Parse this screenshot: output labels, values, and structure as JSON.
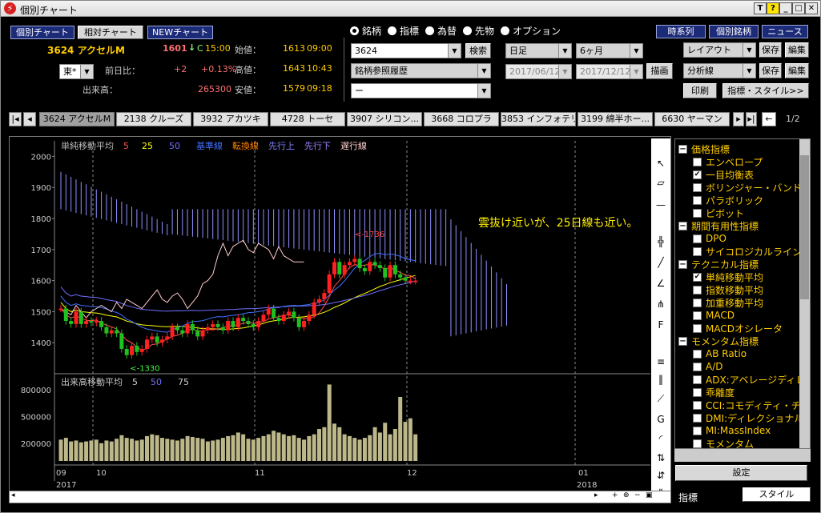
{
  "window": {
    "title": "個別チャート",
    "app_icon": "⚡",
    "buttons": [
      "T",
      "?",
      "_",
      "□",
      "✕"
    ]
  },
  "top_buttons": {
    "kobetsu": "個別チャート",
    "soutai": "相対チャート",
    "new_chart": "NEWチャート",
    "jikeiretsu": "時系列",
    "kobetsu_meigara": "個別銘柄",
    "news": "ニュース"
  },
  "stock": {
    "code_name": "3624 アクセルM",
    "price": "1601",
    "arrow": "↓",
    "flag": "C",
    "time": "15:00",
    "market": "東*",
    "prev_label": "前日比：",
    "change": "+2",
    "change_pct": "+0.13%",
    "volume_label": "出来高：",
    "volume": "265300",
    "open_label": "始値：",
    "open": "1613",
    "open_time": "09:00",
    "high_label": "高値：",
    "high": "1643",
    "high_time": "10:43",
    "low_label": "安値：",
    "low": "1579",
    "low_time": "09:18"
  },
  "radios": [
    "銘柄",
    "指標",
    "為替",
    "先物",
    "オプション"
  ],
  "search": {
    "code": "3624",
    "search_btn": "検索",
    "history": "銘柄参照履歴",
    "blank": "ー"
  },
  "period": {
    "type": "日足",
    "range": "6ヶ月",
    "from": "2017/06/12",
    "to": "2017/12/12",
    "draw_btn": "描画"
  },
  "right_controls": {
    "layout": "レイアウト",
    "save": "保存",
    "edit": "編集",
    "analysis": "分析線",
    "print": "印刷",
    "style_btn": "指標・スタイル>>"
  },
  "tabs": [
    "3624 アクセルM",
    "2138 クルーズ",
    "3932 アカツキ",
    "4728 トーセ",
    "3907 シリコン...",
    "3668 コロプラ",
    "3853 インフォテリ",
    "3199 綿半ホー...",
    "6630 ヤーマン"
  ],
  "tab_page": "1/2",
  "chart_data": {
    "type": "candlestick",
    "legend": [
      "単純移動平均",
      "5",
      "25",
      "50",
      "基準線",
      "転換線",
      "先行上",
      "先行下",
      "遅行線"
    ],
    "legend_colors": [
      "#bbbbbb",
      "#ff5050",
      "#ffff00",
      "#7070ff",
      "#4070ff",
      "#ff8000",
      "#8080ff",
      "#a080ff",
      "#ffcccc"
    ],
    "ylim": [
      1300,
      2050
    ],
    "yticks": [
      "2000",
      "1900",
      "1800",
      "1700",
      "1600",
      "1500",
      "1400"
    ],
    "annotation": "雲抜け近いが、25日線も近い。",
    "high_label": "<-1736",
    "low_label": "<-1330",
    "close": [
      1510,
      1470,
      1460,
      1500,
      1460,
      1470,
      1465,
      1470,
      1450,
      1430,
      1440,
      1430,
      1380,
      1360,
      1390,
      1370,
      1380,
      1410,
      1420,
      1400,
      1410,
      1420,
      1450,
      1440,
      1430,
      1460,
      1440,
      1420,
      1440,
      1450,
      1460,
      1450,
      1440,
      1470,
      1450,
      1480,
      1470,
      1460,
      1450,
      1470,
      1490,
      1510,
      1480,
      1470,
      1490,
      1500,
      1480,
      1450,
      1470,
      1490,
      1530,
      1540,
      1560,
      1620,
      1660,
      1620,
      1650,
      1660,
      1670,
      1640,
      1630,
      1660,
      1650,
      1640,
      1610,
      1650,
      1620,
      1610,
      1600,
      1600,
      1600
    ],
    "volume_legend": [
      "出来高移動平均",
      "5",
      "50",
      "75"
    ],
    "volume_yticks": [
      "800000",
      "500000",
      "200000"
    ],
    "volume_ylim": [
      0,
      900000
    ],
    "volume": [
      240000,
      260000,
      220000,
      230000,
      210000,
      220000,
      230000,
      240000,
      200000,
      230000,
      220000,
      250000,
      290000,
      260000,
      250000,
      230000,
      240000,
      280000,
      300000,
      290000,
      260000,
      250000,
      240000,
      230000,
      250000,
      280000,
      270000,
      260000,
      250000,
      220000,
      230000,
      240000,
      260000,
      280000,
      290000,
      320000,
      300000,
      250000,
      240000,
      260000,
      280000,
      300000,
      340000,
      320000,
      300000,
      280000,
      290000,
      260000,
      240000,
      280000,
      300000,
      360000,
      380000,
      860000,
      420000,
      380000,
      300000,
      280000,
      260000,
      240000,
      260000,
      290000,
      380000,
      320000,
      430000,
      300000,
      360000,
      720000,
      440000,
      480000,
      300000,
      260000
    ],
    "x_months": [
      "09",
      "10",
      "11",
      "12",
      "01"
    ],
    "x_years": [
      "2017",
      "2018"
    ]
  },
  "indicator_tree": [
    {
      "label": "価格指標",
      "group": true
    },
    {
      "label": "エンベロープ",
      "checked": false
    },
    {
      "label": "一目均衡表",
      "checked": true
    },
    {
      "label": "ボリンジャー・バンド",
      "checked": false
    },
    {
      "label": "パラボリック",
      "checked": false
    },
    {
      "label": "ピボット",
      "checked": false
    },
    {
      "label": "期間有用性指標",
      "group": true
    },
    {
      "label": "DPO",
      "checked": false
    },
    {
      "label": "サイコロジカルライン",
      "checked": false
    },
    {
      "label": "テクニカル指標",
      "group": true
    },
    {
      "label": "単純移動平均",
      "checked": true
    },
    {
      "label": "指数移動平均",
      "checked": false
    },
    {
      "label": "加重移動平均",
      "checked": false
    },
    {
      "label": "MACD",
      "checked": false
    },
    {
      "label": "MACDオシレータ",
      "checked": false
    },
    {
      "label": "モメンタム指標",
      "group": true
    },
    {
      "label": "AB Ratio",
      "checked": false
    },
    {
      "label": "A/D",
      "checked": false
    },
    {
      "label": "ADX:アベレージディレ",
      "checked": false
    },
    {
      "label": "乖離度",
      "checked": false
    },
    {
      "label": "CCI:コモディティ・チャ",
      "checked": false
    },
    {
      "label": "DMI:ディレクショナル",
      "checked": false
    },
    {
      "label": "MI:MassIndex",
      "checked": false
    },
    {
      "label": "モメンタム",
      "checked": false
    }
  ],
  "settings_btn": "設定",
  "bottom_tabs": [
    "指標",
    "スタイル"
  ]
}
